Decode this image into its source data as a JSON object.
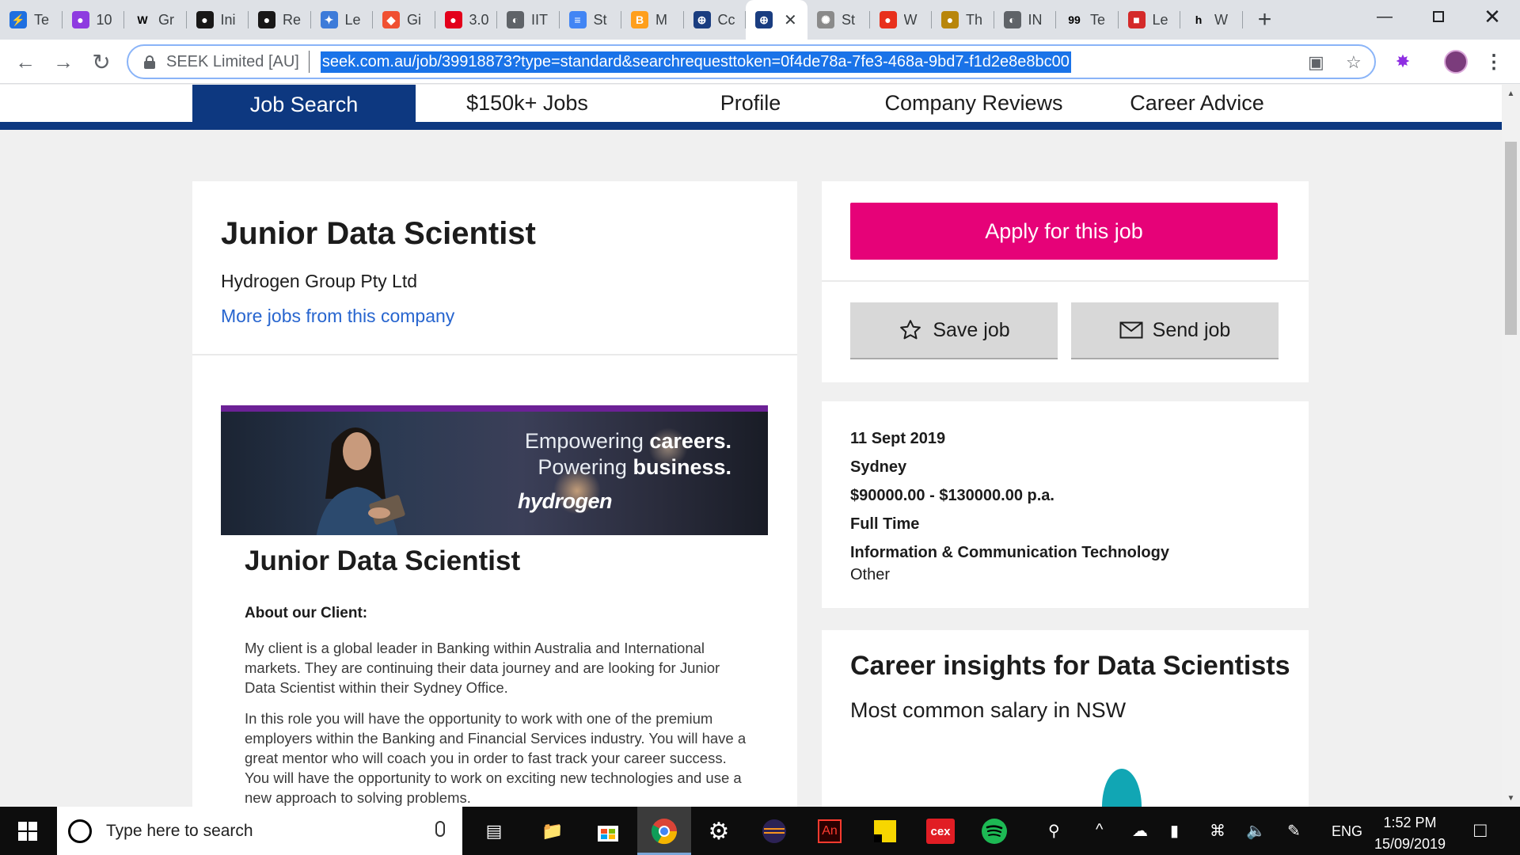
{
  "browser": {
    "tabs": [
      {
        "label": "Te",
        "icon": "slack-icon",
        "color": "#1e6fe0"
      },
      {
        "label": "10",
        "icon": "account-icon",
        "color": "#8e3be0"
      },
      {
        "label": "Gr",
        "icon": "wikipedia-icon",
        "color": "#000000"
      },
      {
        "label": "Ini",
        "icon": "github-icon",
        "color": "#181717"
      },
      {
        "label": "Re",
        "icon": "github-icon",
        "color": "#181717"
      },
      {
        "label": "Le",
        "icon": "puzzle-icon",
        "color": "#3d7bd9"
      },
      {
        "label": "Gi",
        "icon": "git-icon",
        "color": "#f05032"
      },
      {
        "label": "3.0",
        "icon": "red-blob-icon",
        "color": "#e3001b"
      },
      {
        "label": "IIT",
        "icon": "globe-icon",
        "color": "#5f6368"
      },
      {
        "label": "St",
        "icon": "docs-icon",
        "color": "#4285f4"
      },
      {
        "label": "M",
        "icon": "medium-icon",
        "color": "#ff9f1c"
      },
      {
        "label": "Cc",
        "icon": "globe-blue-icon",
        "color": "#1a3d80"
      },
      {
        "label": "",
        "icon": "globe-blue-icon",
        "color": "#1a3d80",
        "active": true
      },
      {
        "label": "St",
        "icon": "spinner-icon",
        "color": "#8a8a8a"
      },
      {
        "label": "W",
        "icon": "tomato-icon",
        "color": "#e8301c"
      },
      {
        "label": "Th",
        "icon": "bulb-icon",
        "color": "#b8860b"
      },
      {
        "label": "IN",
        "icon": "globe-icon",
        "color": "#5f6368"
      },
      {
        "label": "Te",
        "icon": "ninety-nine-icon",
        "color": "#000000"
      },
      {
        "label": "Le",
        "icon": "gift-icon",
        "color": "#d42a2a"
      },
      {
        "label": "W",
        "icon": "h-icon",
        "color": "#000000"
      }
    ],
    "site_identity": "SEEK Limited [AU]",
    "url": "seek.com.au/job/39918873?type=standard&searchrequesttoken=0f4de78a-7fe3-468a-9bd7-f1d2e8e8bc00"
  },
  "site_nav": {
    "items": [
      {
        "label": "Job Search",
        "active": true
      },
      {
        "label": "$150k+ Jobs"
      },
      {
        "label": "Profile"
      },
      {
        "label": "Company Reviews"
      },
      {
        "label": "Career Advice"
      }
    ]
  },
  "job": {
    "title": "Junior Data Scientist",
    "company": "Hydrogen Group Pty Ltd",
    "more_jobs_link": "More jobs from this company",
    "banner": {
      "line1_a": "Empowering ",
      "line1_b": "careers.",
      "line2_a": "Powering ",
      "line2_b": "business.",
      "brand": "hydrogen"
    },
    "description_title": "Junior Data Scientist",
    "about_heading": "About our Client:",
    "para1": "My client is a global leader in Banking within Australia and International markets. They are continuing their data journey and are looking for Junior Data Scientist within their Sydney Office.",
    "para2": "In this role you will have the opportunity to work with one of the premium employers within the Banking and Financial Services industry. You will have a great mentor who will coach you in order to fast track your career success. You will have the opportunity to work on exciting new technologies and use a new approach to solving problems."
  },
  "actions": {
    "apply_label": "Apply for this job",
    "save_label": "Save job",
    "send_label": "Send job"
  },
  "details": {
    "date": "11 Sept 2019",
    "location": "Sydney",
    "salary": "$90000.00 - $130000.00 p.a.",
    "work_type": "Full Time",
    "classification": "Information & Communication Technology",
    "subclassification": "Other"
  },
  "insights": {
    "title": "Career insights for Data Scientists",
    "subtitle": "Most common salary in NSW"
  },
  "taskbar": {
    "search_placeholder": "Type here to search",
    "language": "ENG",
    "time": "1:52 PM",
    "date": "15/09/2019"
  },
  "colors": {
    "seek_navy": "#0d3880",
    "apply_pink": "#e60278",
    "link_blue": "#2765cf",
    "banner_purple": "#6c2196",
    "insight_teal": "#11a6b4"
  }
}
